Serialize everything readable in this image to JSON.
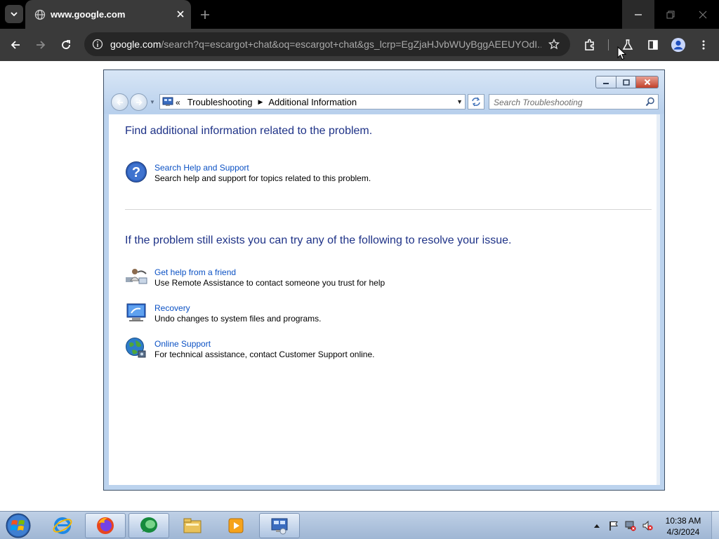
{
  "browser": {
    "tab": {
      "title": "www.google.com"
    },
    "omnibox": {
      "host": "google.com",
      "path": "/search?q=escargot+chat&oq=escargot+chat&gs_lcrp=EgZjaHJvbWUyBggAEEUYOdI..."
    }
  },
  "explorer": {
    "breadcrumb": {
      "root": "Troubleshooting",
      "current": "Additional Information"
    },
    "search_placeholder": "Search Troubleshooting",
    "heading1": "Find additional information related to the problem.",
    "heading2": "If the problem still exists you can try any of the following to resolve your issue.",
    "tasks": [
      {
        "icon": "help-icon",
        "title": "Search Help and Support",
        "desc": "Search help and support for topics related to this problem."
      },
      {
        "icon": "remote-assistance-icon",
        "title": "Get help from a friend",
        "desc": "Use Remote Assistance to contact someone you trust for help"
      },
      {
        "icon": "recovery-icon",
        "title": "Recovery",
        "desc": "Undo changes to system files and programs."
      },
      {
        "icon": "globe-icon",
        "title": "Online Support",
        "desc": "For technical assistance, contact Customer Support online."
      }
    ]
  },
  "taskbar": {
    "clock": {
      "time": "10:38 AM",
      "date": "4/3/2024"
    },
    "items": [
      "internet-explorer-icon",
      "firefox-icon",
      "escargot-icon",
      "file-explorer-icon",
      "media-player-icon",
      "control-panel-icon"
    ]
  },
  "colors": {
    "heading": "#1e3287",
    "link": "#0b51c4",
    "chrome_bg": "#3a3a3a"
  }
}
